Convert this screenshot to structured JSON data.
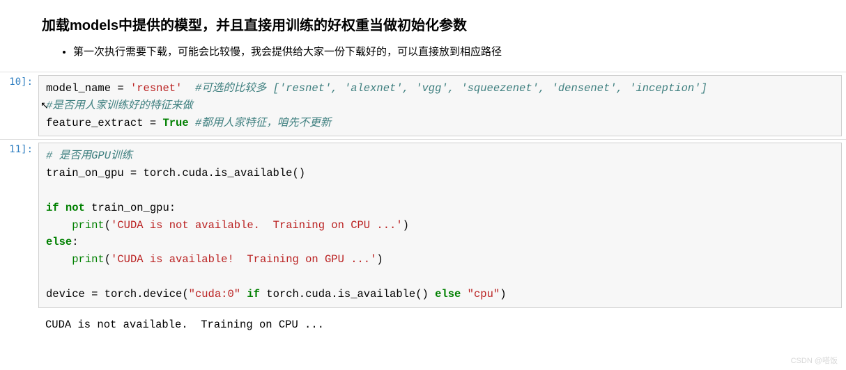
{
  "header": {
    "heading": "加载models中提供的模型，并且直接用训练的好权重当做初始化参数",
    "bullet": "第一次执行需要下载，可能会比较慢，我会提供给大家一份下载好的，可以直接放到相应路径"
  },
  "cell10": {
    "prompt": "10]:",
    "line1": {
      "var": "model_name ",
      "eq": "= ",
      "str": "'resnet'",
      "pad": "  ",
      "comment": "#可选的比较多 ['resnet', 'alexnet', 'vgg', 'squeezenet', 'densenet', 'inception']"
    },
    "line2": {
      "comment": "#是否用人家训练好的特征来做"
    },
    "line3": {
      "var": "feature_extract ",
      "eq": "= ",
      "bool": "True",
      "space": " ",
      "comment": "#都用人家特征，咱先不更新"
    }
  },
  "cell11": {
    "prompt": "11]:",
    "line1": {
      "comment": "# 是否用GPU训练"
    },
    "line2": {
      "text": "train_on_gpu = torch.cuda.is_available()"
    },
    "line3": {
      "text": ""
    },
    "line4": {
      "kw1": "if",
      "sp1": " ",
      "kw2": "not",
      "sp2": " ",
      "rest": "train_on_gpu:"
    },
    "line5": {
      "indent": "    ",
      "fn": "print",
      "open": "(",
      "str": "'CUDA is not available.  Training on CPU ...'",
      "close": ")"
    },
    "line6": {
      "kw": "else",
      "colon": ":"
    },
    "line7": {
      "indent": "    ",
      "fn": "print",
      "open": "(",
      "str": "'CUDA is available!  Training on GPU ...'",
      "close": ")"
    },
    "line8": {
      "text": ""
    },
    "line9": {
      "a": "device = torch.device(",
      "str": "\"cuda:0\"",
      "sp": " ",
      "kw1": "if",
      "mid": " torch.cuda.is_available() ",
      "kw2": "else",
      "sp2": " ",
      "str2": "\"cpu\"",
      "close": ")"
    },
    "output": "CUDA is not available.  Training on CPU ..."
  },
  "watermark": "CSDN @嗒饭"
}
